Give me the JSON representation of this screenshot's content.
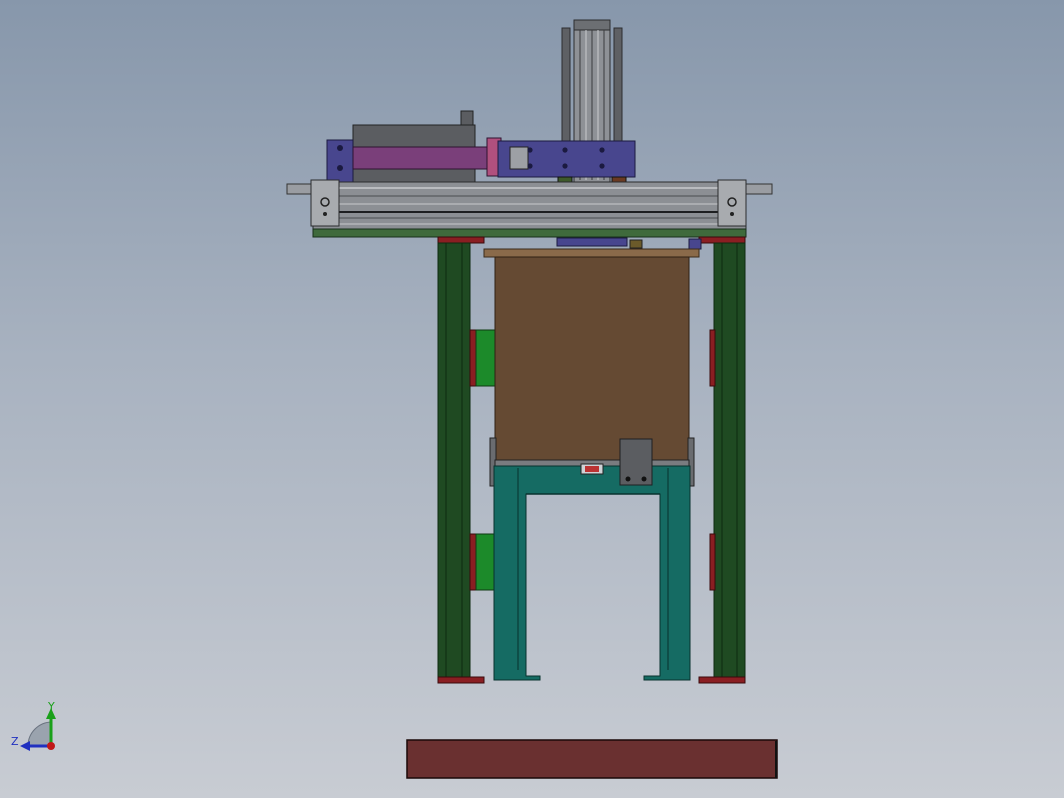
{
  "view": {
    "background_top": "#8797ab",
    "background_bottom": "#c8ccd3"
  },
  "triad": {
    "y_label": "Y",
    "z_label": "Z",
    "y_color": "#1aa01a",
    "z_color": "#2030c0",
    "x_color": "#c01818"
  },
  "colors": {
    "frame_green": "#1f4a22",
    "frame_edge": "#0e2a10",
    "maroon": "#8a1e22",
    "brown_box": "#654a33",
    "brown_lid": "#8a6a4a",
    "teal_stand": "#156b63",
    "purple_plate": "#48468e",
    "magenta_cylinder": "#7a3f7a",
    "rail_gray": "#8c8f94",
    "dark_gray": "#5b5d61",
    "bright_green": "#1c8a2a",
    "floor_plate": "#6a3030"
  }
}
